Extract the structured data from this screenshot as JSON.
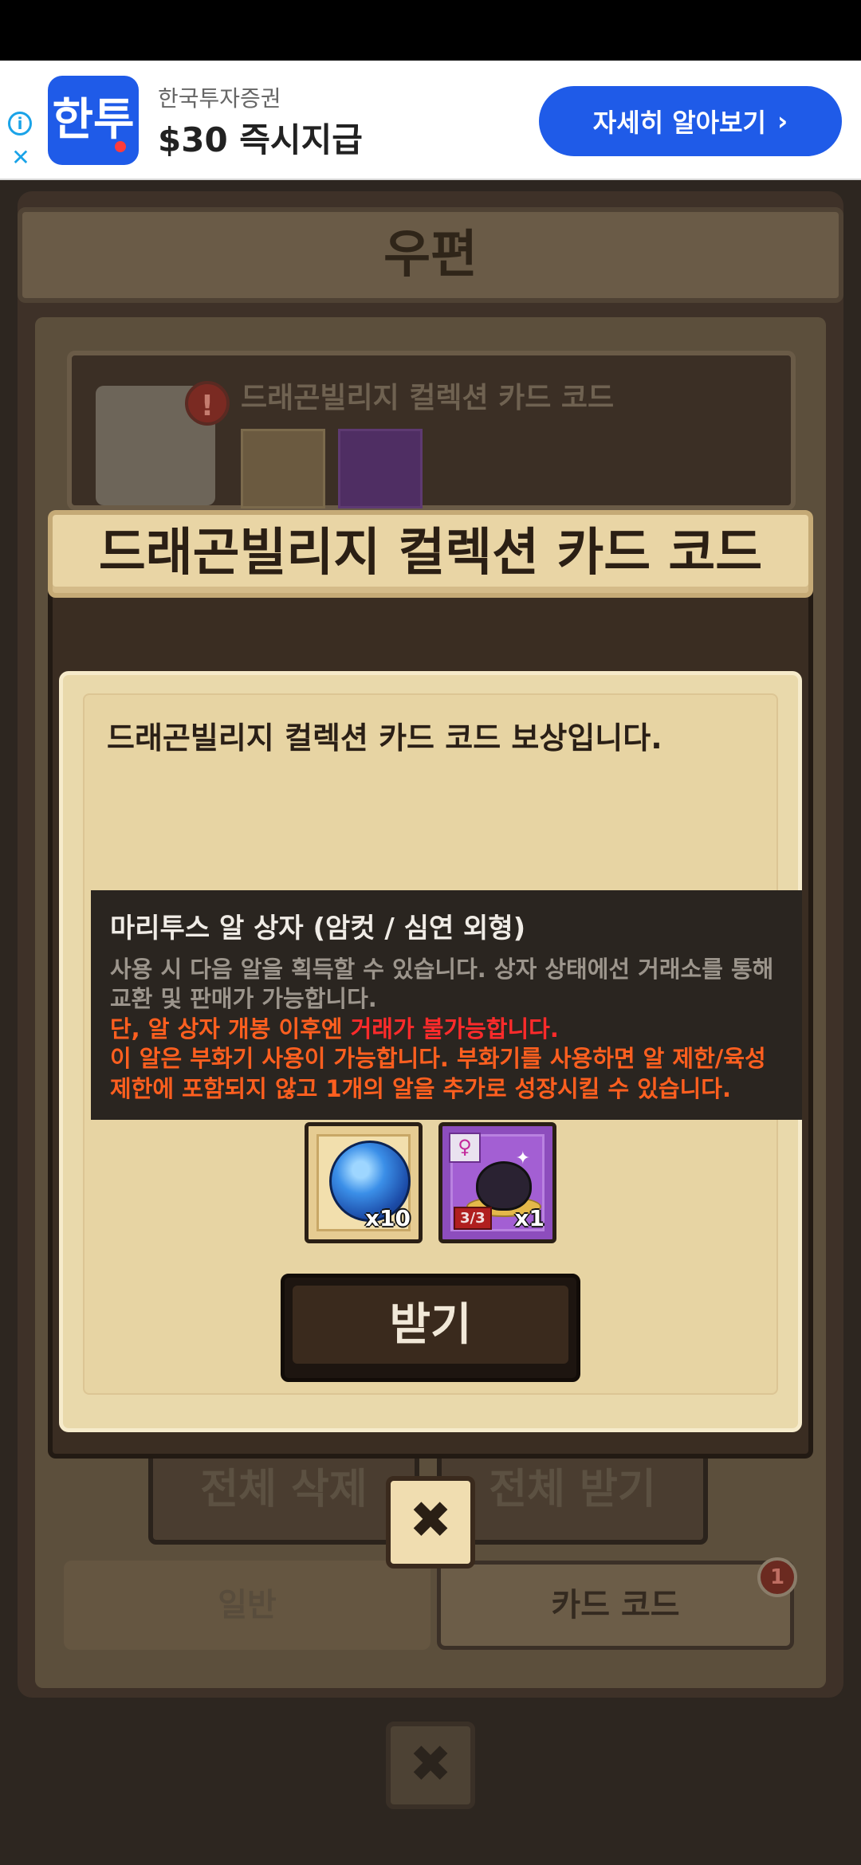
{
  "ad": {
    "app_icon_text": "한투",
    "brand": "한국투자증권",
    "headline": "$30 즉시지급",
    "cta": "자세히 알아보기",
    "cta_arrow": "›",
    "info_glyph": "i",
    "close_glyph": "✕"
  },
  "mailbox": {
    "title": "우편",
    "mail_subject": "드래곤빌리지 컬렉션 카드 코드",
    "alert_glyph": "!",
    "delete_all": "전체 삭제",
    "receive_all": "전체 받기",
    "tab_general": "일반",
    "tab_card_code": "카드 코드",
    "tab_badge": "1",
    "close_glyph": "✖"
  },
  "dialog": {
    "title": "드래곤빌리지 컬렉션 카드 코드",
    "message": "드래곤빌리지 컬렉션 카드 코드 보상입니다.",
    "tooltip": {
      "title": "마리투스 알 상자 (암컷 / 심연 외형)",
      "line1": "사용 시 다음 알을 획득할 수 있습니다. 상자 상태에선 거래소를 통해",
      "line2": "교환 및 판매가 가능합니다.",
      "line3_a": "단, 알 상자 개봉 이후엔 ",
      "line3_b": "거래가 불가능합니다.",
      "line4": "이 알은 부화기 사용이 가능합니다. 부화기를 사용하면 알 제한/육성",
      "line5": "제한에 포함되지 않고 1개의 알을 추가로 성장시킬 수 있습니다."
    },
    "rewards": [
      {
        "icon": "blue-orb-icon",
        "qty": "x10"
      },
      {
        "icon": "dragon-egg-icon",
        "qty": "x1",
        "stage": "3/3",
        "gender_glyph": "♀"
      }
    ],
    "receive_button": "받기",
    "close_glyph": "✖"
  },
  "colors": {
    "ad_blue": "#1f5be8",
    "dialog_parchment": "#e9d9ab",
    "warning_orange": "#ff5f1f",
    "warning_red": "#ff2b2b"
  }
}
